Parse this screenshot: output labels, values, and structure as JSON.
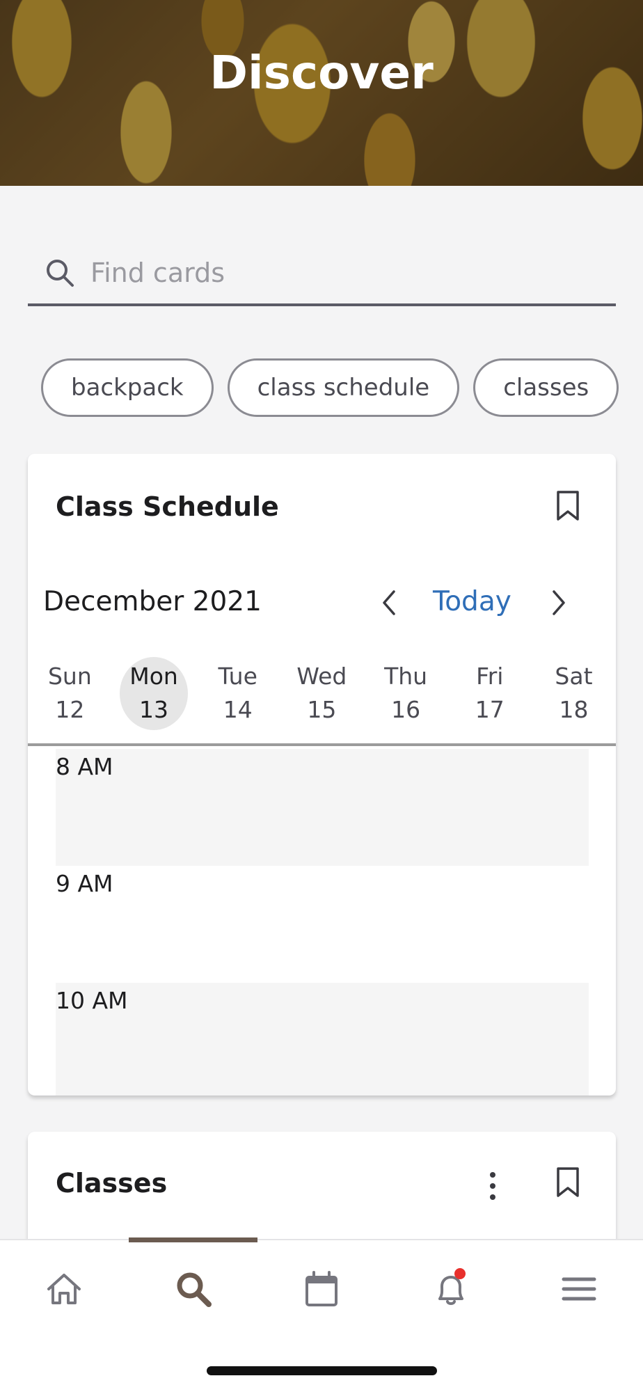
{
  "header": {
    "title": "Discover"
  },
  "search": {
    "placeholder": "Find cards",
    "value": ""
  },
  "chips": [
    "backpack",
    "class schedule",
    "classes"
  ],
  "schedule_card": {
    "title": "Class Schedule",
    "month": "December 2021",
    "today_label": "Today",
    "days": [
      {
        "name": "Sun",
        "num": "12"
      },
      {
        "name": "Mon",
        "num": "13",
        "active": true
      },
      {
        "name": "Tue",
        "num": "14"
      },
      {
        "name": "Wed",
        "num": "15"
      },
      {
        "name": "Thu",
        "num": "16"
      },
      {
        "name": "Fri",
        "num": "17"
      },
      {
        "name": "Sat",
        "num": "18"
      }
    ],
    "slots": [
      "8 AM",
      "9 AM",
      "10 AM"
    ]
  },
  "classes_card": {
    "title": "Classes"
  },
  "bottom_nav": {
    "items": [
      "home-icon",
      "search-icon",
      "calendar-icon",
      "bell-icon",
      "menu-icon"
    ],
    "active_index": 1,
    "notification_dot_color": "#e8302c"
  },
  "colors": {
    "accent": "#2f6eb7",
    "nav_active": "#6b5b50"
  }
}
